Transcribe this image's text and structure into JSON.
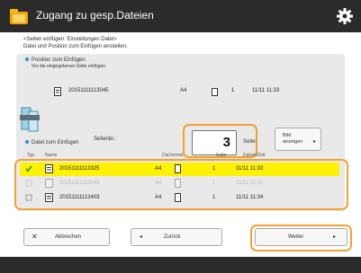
{
  "window": {
    "title": "Zugang zu gesp.Dateien"
  },
  "instructions": [
    "<Seiten einfügen: Einstellungen Datei>",
    "Datei und Position zum Einfügen einstellen."
  ],
  "position_section": {
    "title": "Position zum Einfügen",
    "subtitle": "Vor die eingegebenen Seite einfügen.",
    "file": {
      "name": "20151111113045",
      "size": "A4",
      "pages": "1",
      "date": "11/11 11:33"
    },
    "page_label": "Seitenbr.:",
    "page_value": "3",
    "page_unit": "Seite",
    "preview_label": [
      "Bild",
      "anzeigen"
    ]
  },
  "insert_section": {
    "title": "Datei zum Einfügen",
    "columns": [
      "Typ",
      "Name",
      "Dat.format",
      "Seite",
      "Datum/Zeit"
    ],
    "rows": [
      {
        "name": "20151111113325",
        "size": "A4",
        "pages": "1",
        "date": "11/11 11:33",
        "selected": true
      },
      {
        "name": "20151111113045",
        "size": "A4",
        "pages": "1",
        "date": "11/11 11:32",
        "selected": false
      },
      {
        "name": "20151111113403",
        "size": "A4",
        "pages": "1",
        "date": "11/11 11:34",
        "selected": false
      }
    ]
  },
  "buttons": {
    "cancel": "Abbrechen",
    "back": "Zurück",
    "next": "Weiter"
  },
  "icons": {
    "app": "folder-icon",
    "settings": "gear-icon",
    "file": "file-icon",
    "printer": "printer-icon"
  },
  "colors": {
    "accent": "#f2a233",
    "selection": "#fff200",
    "titlebar": "#2b2b2b",
    "panel": "#e9e9e9"
  }
}
